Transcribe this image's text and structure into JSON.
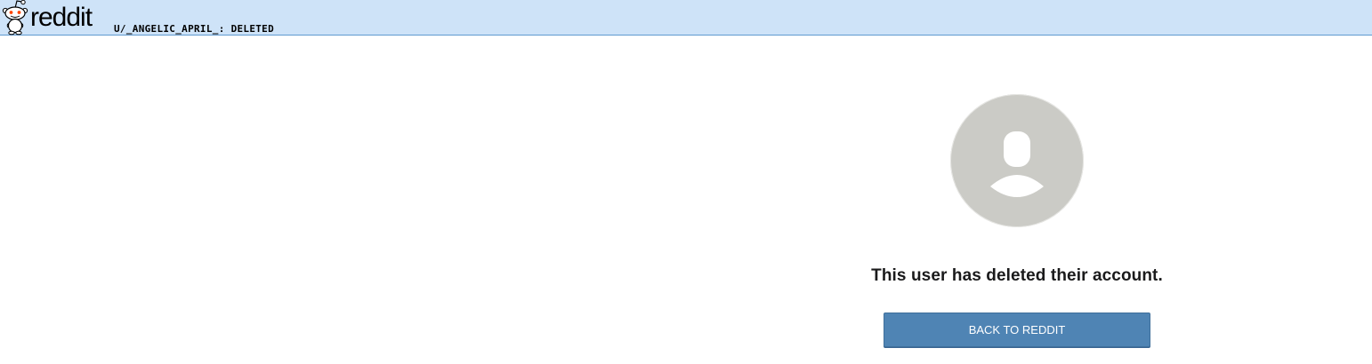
{
  "header": {
    "logo_text": "reddit",
    "page_title_user": "u/_angelic_april_",
    "page_title_separator": ":",
    "page_title_status": "deleted",
    "background_color": "#cee3f8"
  },
  "main": {
    "avatar_icon": "default-user-avatar-icon",
    "message": "This user has deleted their account.",
    "back_button_label": "BACK TO REDDIT",
    "button_color": "#4f84b4"
  }
}
